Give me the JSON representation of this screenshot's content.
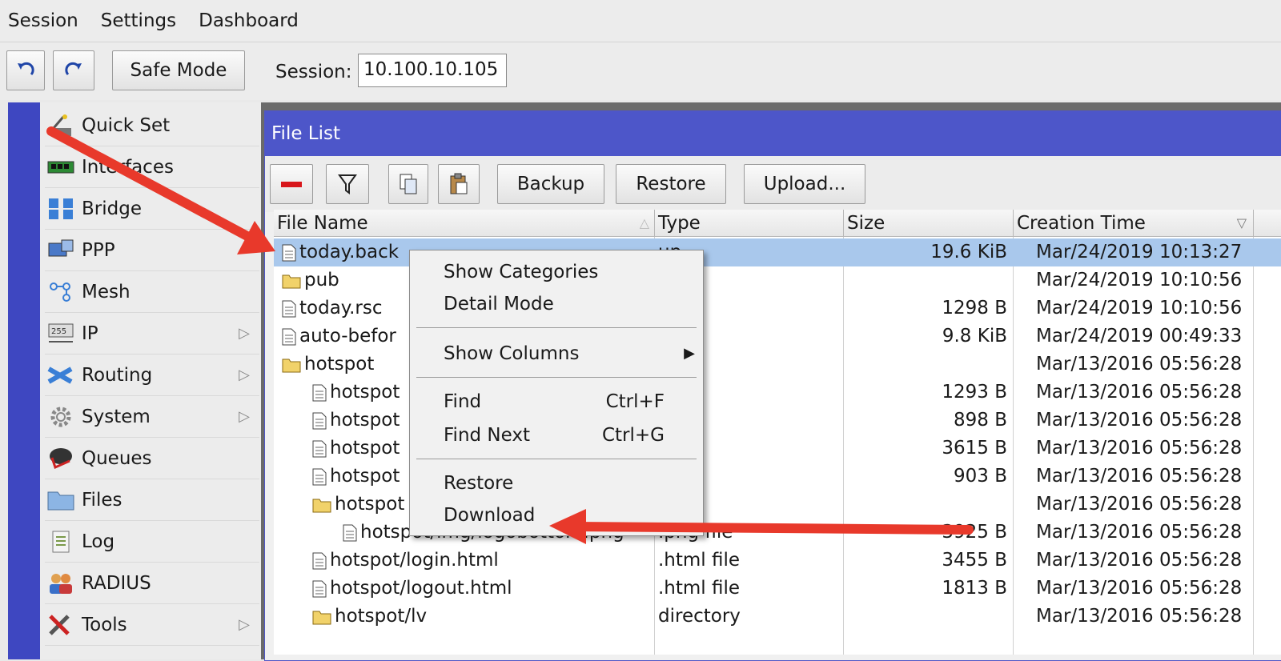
{
  "menubar": {
    "session": "Session",
    "settings": "Settings",
    "dashboard": "Dashboard"
  },
  "toolbar": {
    "safe_mode": "Safe Mode",
    "session_label": "Session:",
    "session_value": "10.100.10.105"
  },
  "sidebar": {
    "items": [
      {
        "label": "Quick Set",
        "icon": "wand-icon"
      },
      {
        "label": "Interfaces",
        "icon": "network-card-icon"
      },
      {
        "label": "Bridge",
        "icon": "bridge-icon"
      },
      {
        "label": "PPP",
        "icon": "ppp-icon"
      },
      {
        "label": "Mesh",
        "icon": "mesh-icon"
      },
      {
        "label": "IP",
        "icon": "ip-icon"
      },
      {
        "label": "Routing",
        "icon": "routing-icon"
      },
      {
        "label": "System",
        "icon": "gear-icon"
      },
      {
        "label": "Queues",
        "icon": "queue-icon"
      },
      {
        "label": "Files",
        "icon": "folder-icon"
      },
      {
        "label": "Log",
        "icon": "log-icon"
      },
      {
        "label": "RADIUS",
        "icon": "users-icon"
      },
      {
        "label": "Tools",
        "icon": "tools-icon"
      }
    ]
  },
  "window": {
    "title": "File List",
    "buttons": {
      "backup": "Backup",
      "restore": "Restore",
      "upload": "Upload..."
    }
  },
  "table": {
    "columns": [
      "File Name",
      "Type",
      "Size",
      "Creation Time"
    ],
    "rows": [
      {
        "name": "today.back",
        "type": "up",
        "size": "19.6 KiB",
        "time": "Mar/24/2019 10:13:27",
        "kind": "file",
        "indent": 0
      },
      {
        "name": "pub",
        "type": "tory",
        "size": "",
        "time": "Mar/24/2019 10:10:56",
        "kind": "folder",
        "indent": 0
      },
      {
        "name": "today.rsc",
        "type": "t",
        "size": "1298 B",
        "time": "Mar/24/2019 10:10:56",
        "kind": "file",
        "indent": 0
      },
      {
        "name": "auto-befor",
        "type": "up",
        "size": "9.8 KiB",
        "time": "Mar/24/2019 00:49:33",
        "kind": "file",
        "indent": 0
      },
      {
        "name": "hotspot",
        "type": "tory",
        "size": "",
        "time": "Mar/13/2016 05:56:28",
        "kind": "folder",
        "indent": 0
      },
      {
        "name": "hotspot",
        "type": " file",
        "size": "1293 B",
        "time": "Mar/13/2016 05:56:28",
        "kind": "file",
        "indent": 1
      },
      {
        "name": "hotspot",
        "type": " file",
        "size": "898 B",
        "time": "Mar/13/2016 05:56:28",
        "kind": "file",
        "indent": 1
      },
      {
        "name": "hotspot",
        "type": "ile",
        "size": "3615 B",
        "time": "Mar/13/2016 05:56:28",
        "kind": "file",
        "indent": 1
      },
      {
        "name": "hotspot",
        "type": "ile",
        "size": "903 B",
        "time": "Mar/13/2016 05:56:28",
        "kind": "file",
        "indent": 1
      },
      {
        "name": "hotspot",
        "type": "tory",
        "size": "",
        "time": "Mar/13/2016 05:56:28",
        "kind": "folder",
        "indent": 1
      },
      {
        "name": "hotspot/img/logobottom.png",
        "type": ".png file",
        "size": "3925 B",
        "time": "Mar/13/2016 05:56:28",
        "kind": "file",
        "indent": 2
      },
      {
        "name": "hotspot/login.html",
        "type": ".html file",
        "size": "3455 B",
        "time": "Mar/13/2016 05:56:28",
        "kind": "file",
        "indent": 1
      },
      {
        "name": "hotspot/logout.html",
        "type": ".html file",
        "size": "1813 B",
        "time": "Mar/13/2016 05:56:28",
        "kind": "file",
        "indent": 1
      },
      {
        "name": "hotspot/lv",
        "type": "directory",
        "size": "",
        "time": "Mar/13/2016 05:56:28",
        "kind": "folder",
        "indent": 1
      }
    ]
  },
  "context_menu": {
    "show_categories": "Show Categories",
    "detail_mode": "Detail Mode",
    "show_columns": "Show Columns",
    "find": "Find",
    "find_shortcut": "Ctrl+F",
    "find_next": "Find Next",
    "find_next_shortcut": "Ctrl+G",
    "restore": "Restore",
    "download": "Download"
  },
  "colors": {
    "accent": "#4d56c9",
    "selected_row": "#a9c8ec",
    "arrow": "#e8392b"
  }
}
